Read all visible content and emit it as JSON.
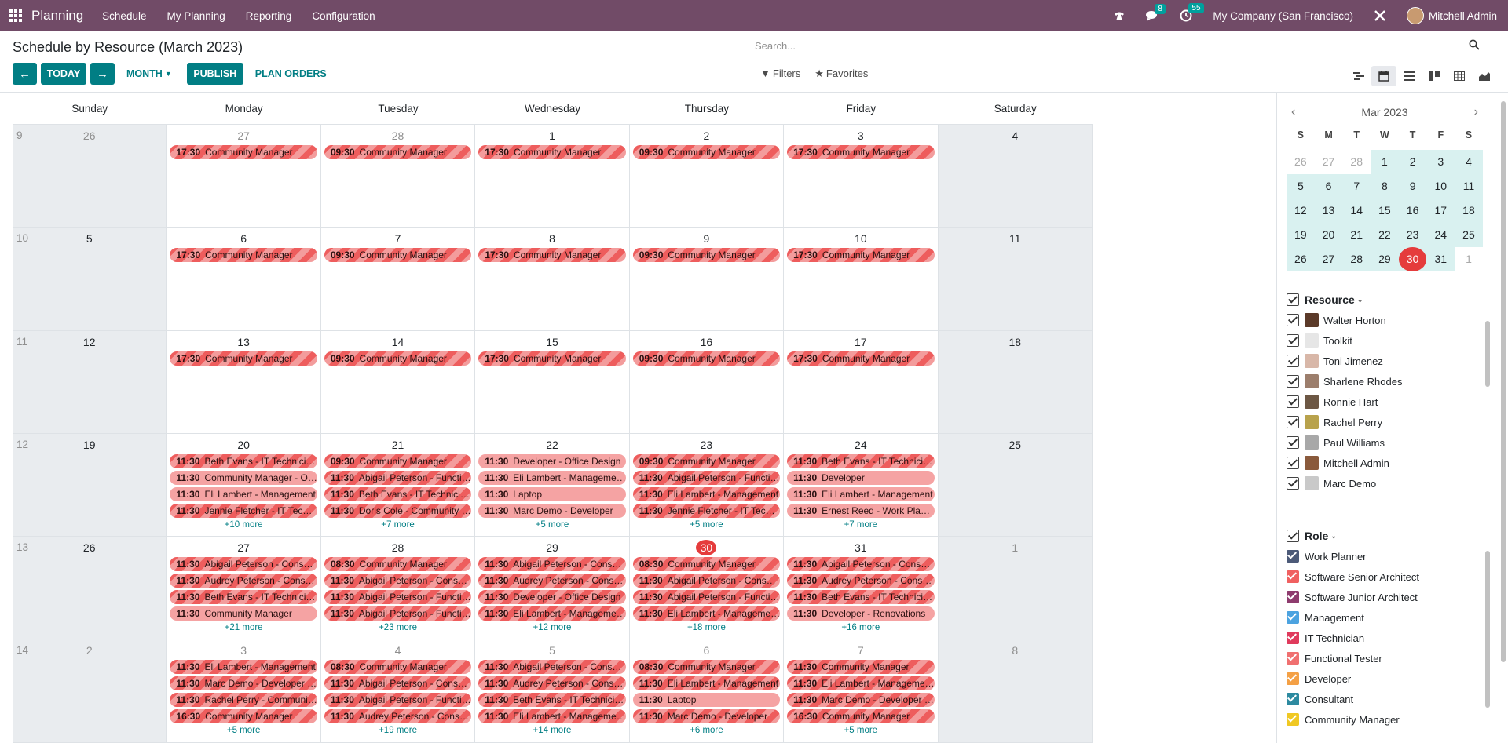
{
  "topbar": {
    "brand": "Planning",
    "menu": [
      "Schedule",
      "My Planning",
      "Reporting",
      "Configuration"
    ],
    "messages_badge": "8",
    "activities_badge": "55",
    "company": "My Company (San Francisco)",
    "user": "Mitchell Admin",
    "accent": "#714b67"
  },
  "control": {
    "title": "Schedule by Resource (March 2023)",
    "search_placeholder": "Search...",
    "prev_label": "←",
    "next_label": "→",
    "today_label": "TODAY",
    "scale_label": "MONTH",
    "publish_label": "PUBLISH",
    "plan_orders_label": "PLAN ORDERS",
    "filters_label": "Filters",
    "favorites_label": "Favorites",
    "primary": "#017e84"
  },
  "calendar": {
    "weekdays": [
      "Sunday",
      "Monday",
      "Tuesday",
      "Wednesday",
      "Thursday",
      "Friday",
      "Saturday"
    ],
    "weeks": [
      {
        "num": "9",
        "days": [
          {
            "d": "26",
            "dim": true,
            "events": [],
            "more": ""
          },
          {
            "d": "27",
            "dim": true,
            "events": [
              {
                "t": "17:30",
                "n": "Community Manager",
                "s": true
              }
            ],
            "more": ""
          },
          {
            "d": "28",
            "dim": true,
            "events": [
              {
                "t": "09:30",
                "n": "Community Manager",
                "s": true
              }
            ],
            "more": ""
          },
          {
            "d": "1",
            "events": [
              {
                "t": "17:30",
                "n": "Community Manager",
                "s": true
              }
            ],
            "more": ""
          },
          {
            "d": "2",
            "events": [
              {
                "t": "09:30",
                "n": "Community Manager",
                "s": true
              }
            ],
            "more": ""
          },
          {
            "d": "3",
            "events": [
              {
                "t": "17:30",
                "n": "Community Manager",
                "s": true
              }
            ],
            "more": ""
          },
          {
            "d": "4",
            "events": [],
            "more": ""
          }
        ]
      },
      {
        "num": "10",
        "days": [
          {
            "d": "5",
            "events": [],
            "more": ""
          },
          {
            "d": "6",
            "events": [
              {
                "t": "17:30",
                "n": "Community Manager",
                "s": true
              }
            ],
            "more": ""
          },
          {
            "d": "7",
            "events": [
              {
                "t": "09:30",
                "n": "Community Manager",
                "s": true
              }
            ],
            "more": ""
          },
          {
            "d": "8",
            "events": [
              {
                "t": "17:30",
                "n": "Community Manager",
                "s": true
              }
            ],
            "more": ""
          },
          {
            "d": "9",
            "events": [
              {
                "t": "09:30",
                "n": "Community Manager",
                "s": true
              }
            ],
            "more": ""
          },
          {
            "d": "10",
            "events": [
              {
                "t": "17:30",
                "n": "Community Manager",
                "s": true
              }
            ],
            "more": ""
          },
          {
            "d": "11",
            "events": [],
            "more": ""
          }
        ]
      },
      {
        "num": "11",
        "days": [
          {
            "d": "12",
            "events": [],
            "more": ""
          },
          {
            "d": "13",
            "events": [
              {
                "t": "17:30",
                "n": "Community Manager",
                "s": true
              }
            ],
            "more": ""
          },
          {
            "d": "14",
            "events": [
              {
                "t": "09:30",
                "n": "Community Manager",
                "s": true
              }
            ],
            "more": ""
          },
          {
            "d": "15",
            "events": [
              {
                "t": "17:30",
                "n": "Community Manager",
                "s": true
              }
            ],
            "more": ""
          },
          {
            "d": "16",
            "events": [
              {
                "t": "09:30",
                "n": "Community Manager",
                "s": true
              }
            ],
            "more": ""
          },
          {
            "d": "17",
            "events": [
              {
                "t": "17:30",
                "n": "Community Manager",
                "s": true
              }
            ],
            "more": ""
          },
          {
            "d": "18",
            "events": [],
            "more": ""
          }
        ]
      },
      {
        "num": "12",
        "days": [
          {
            "d": "19",
            "events": [],
            "more": ""
          },
          {
            "d": "20",
            "events": [
              {
                "t": "11:30",
                "n": "Beth Evans - IT Technician - S...",
                "s": true
              },
              {
                "t": "11:30",
                "n": "Community Manager - Offic...",
                "s": false
              },
              {
                "t": "11:30",
                "n": "Eli Lambert - Management",
                "s": false
              },
              {
                "t": "11:30",
                "n": "Jennie Fletcher - IT Technici...",
                "s": true
              }
            ],
            "more": "+10 more"
          },
          {
            "d": "21",
            "events": [
              {
                "t": "09:30",
                "n": "Community Manager",
                "s": true
              },
              {
                "t": "11:30",
                "n": "Abigail Peterson - Functiona...",
                "s": true
              },
              {
                "t": "11:30",
                "n": "Beth Evans - IT Technician - S...",
                "s": true
              },
              {
                "t": "11:30",
                "n": "Doris Cole - Community Man...",
                "s": true
              }
            ],
            "more": "+7 more"
          },
          {
            "d": "22",
            "events": [
              {
                "t": "11:30",
                "n": "Developer - Office Design",
                "s": false
              },
              {
                "t": "11:30",
                "n": "Eli Lambert - Management - ...",
                "s": false
              },
              {
                "t": "11:30",
                "n": "Laptop",
                "s": false
              },
              {
                "t": "11:30",
                "n": "Marc Demo - Developer",
                "s": false
              }
            ],
            "more": "+5 more"
          },
          {
            "d": "23",
            "events": [
              {
                "t": "09:30",
                "n": "Community Manager",
                "s": true
              },
              {
                "t": "11:30",
                "n": "Abigail Peterson - Functiona...",
                "s": true
              },
              {
                "t": "11:30",
                "n": "Eli Lambert - Management",
                "s": true
              },
              {
                "t": "11:30",
                "n": "Jennie Fletcher - IT Technici...",
                "s": true
              }
            ],
            "more": "+5 more"
          },
          {
            "d": "24",
            "events": [
              {
                "t": "11:30",
                "n": "Beth Evans - IT Technician - S...",
                "s": true
              },
              {
                "t": "11:30",
                "n": "Developer",
                "s": false
              },
              {
                "t": "11:30",
                "n": "Eli Lambert - Management",
                "s": false
              },
              {
                "t": "11:30",
                "n": "Ernest Reed - Work Planner - ...",
                "s": false
              }
            ],
            "more": "+7 more"
          },
          {
            "d": "25",
            "events": [],
            "more": ""
          }
        ]
      },
      {
        "num": "13",
        "days": [
          {
            "d": "26",
            "events": [],
            "more": ""
          },
          {
            "d": "27",
            "events": [
              {
                "t": "11:30",
                "n": "Abigail Peterson - Consultant",
                "s": true
              },
              {
                "t": "11:30",
                "n": "Audrey Peterson - Consultan...",
                "s": true
              },
              {
                "t": "11:30",
                "n": "Beth Evans - IT Technician - S...",
                "s": true
              },
              {
                "t": "11:30",
                "n": "Community Manager",
                "s": false
              }
            ],
            "more": "+21 more"
          },
          {
            "d": "28",
            "events": [
              {
                "t": "08:30",
                "n": "Community Manager",
                "s": true
              },
              {
                "t": "11:30",
                "n": "Abigail Peterson - Consultant",
                "s": true
              },
              {
                "t": "11:30",
                "n": "Abigail Peterson - Functiona...",
                "s": true
              },
              {
                "t": "11:30",
                "n": "Abigail Peterson - Functiona...",
                "s": true
              }
            ],
            "more": "+23 more"
          },
          {
            "d": "29",
            "events": [
              {
                "t": "11:30",
                "n": "Abigail Peterson - Consultant",
                "s": true
              },
              {
                "t": "11:30",
                "n": "Audrey Peterson - Consultant",
                "s": true
              },
              {
                "t": "11:30",
                "n": "Developer - Office Design",
                "s": true
              },
              {
                "t": "11:30",
                "n": "Eli Lambert - Management - ...",
                "s": true
              }
            ],
            "more": "+12 more"
          },
          {
            "d": "30",
            "today": true,
            "events": [
              {
                "t": "08:30",
                "n": "Community Manager",
                "s": true
              },
              {
                "t": "11:30",
                "n": "Abigail Peterson - Consultant",
                "s": true
              },
              {
                "t": "11:30",
                "n": "Abigail Peterson - Functiona...",
                "s": true
              },
              {
                "t": "11:30",
                "n": "Eli Lambert - Management - ...",
                "s": true
              }
            ],
            "more": "+18 more"
          },
          {
            "d": "31",
            "events": [
              {
                "t": "11:30",
                "n": "Abigail Peterson - Consultant",
                "s": true
              },
              {
                "t": "11:30",
                "n": "Audrey Peterson - Consultant",
                "s": true
              },
              {
                "t": "11:30",
                "n": "Beth Evans - IT Technician - S...",
                "s": true
              },
              {
                "t": "11:30",
                "n": "Developer - Renovations",
                "s": false
              }
            ],
            "more": "+16 more"
          },
          {
            "d": "1",
            "dim": true,
            "events": [],
            "more": ""
          }
        ]
      },
      {
        "num": "14",
        "days": [
          {
            "d": "2",
            "dim": true,
            "events": [],
            "more": ""
          },
          {
            "d": "3",
            "dim": true,
            "events": [
              {
                "t": "11:30",
                "n": "Eli Lambert - Management",
                "s": true
              },
              {
                "t": "11:30",
                "n": "Marc Demo - Developer - Re...",
                "s": true
              },
              {
                "t": "11:30",
                "n": "Rachel Perry - Community M...",
                "s": true
              },
              {
                "t": "16:30",
                "n": "Community Manager",
                "s": true
              }
            ],
            "more": "+5 more"
          },
          {
            "d": "4",
            "dim": true,
            "events": [
              {
                "t": "08:30",
                "n": "Community Manager",
                "s": true
              },
              {
                "t": "11:30",
                "n": "Abigail Peterson - Consultant",
                "s": true
              },
              {
                "t": "11:30",
                "n": "Abigail Peterson - Functiona...",
                "s": true
              },
              {
                "t": "11:30",
                "n": "Audrey Peterson - Consultant",
                "s": true
              }
            ],
            "more": "+19 more"
          },
          {
            "d": "5",
            "dim": true,
            "events": [
              {
                "t": "11:30",
                "n": "Abigail Peterson - Consultant",
                "s": true
              },
              {
                "t": "11:30",
                "n": "Audrey Peterson - Consultant",
                "s": true
              },
              {
                "t": "11:30",
                "n": "Beth Evans - IT Technician - S...",
                "s": true
              },
              {
                "t": "11:30",
                "n": "Eli Lambert - Management - ...",
                "s": true
              }
            ],
            "more": "+14 more"
          },
          {
            "d": "6",
            "dim": true,
            "events": [
              {
                "t": "08:30",
                "n": "Community Manager",
                "s": true
              },
              {
                "t": "11:30",
                "n": "Eli Lambert - Management",
                "s": true
              },
              {
                "t": "11:30",
                "n": "Laptop",
                "s": false
              },
              {
                "t": "11:30",
                "n": "Marc Demo - Developer",
                "s": true
              }
            ],
            "more": "+6 more"
          },
          {
            "d": "7",
            "dim": true,
            "events": [
              {
                "t": "11:30",
                "n": "Community Manager",
                "s": true
              },
              {
                "t": "11:30",
                "n": "Eli Lambert - Management - ...",
                "s": true
              },
              {
                "t": "11:30",
                "n": "Marc Demo - Developer - Re...",
                "s": true
              },
              {
                "t": "16:30",
                "n": "Community Manager",
                "s": true
              }
            ],
            "more": "+5 more"
          },
          {
            "d": "8",
            "dim": true,
            "events": [],
            "more": ""
          }
        ]
      }
    ]
  },
  "mini_calendar": {
    "title": "Mar 2023",
    "dow": [
      "S",
      "M",
      "T",
      "W",
      "T",
      "F",
      "S"
    ],
    "rows": [
      [
        "26",
        "27",
        "28",
        "1",
        "2",
        "3",
        "4"
      ],
      [
        "5",
        "6",
        "7",
        "8",
        "9",
        "10",
        "11"
      ],
      [
        "12",
        "13",
        "14",
        "15",
        "16",
        "17",
        "18"
      ],
      [
        "19",
        "20",
        "21",
        "22",
        "23",
        "24",
        "25"
      ],
      [
        "26",
        "27",
        "28",
        "29",
        "30",
        "31",
        "1"
      ]
    ]
  },
  "resource_filter": {
    "label": "Resource",
    "items": [
      {
        "name": "Walter Horton",
        "color": "#5b3a29"
      },
      {
        "name": "Toolkit",
        "color": "#e6e6e6"
      },
      {
        "name": "Toni Jimenez",
        "color": "#d8b7a8"
      },
      {
        "name": "Sharlene Rhodes",
        "color": "#9c7e6c"
      },
      {
        "name": "Ronnie Hart",
        "color": "#6d5744"
      },
      {
        "name": "Rachel Perry",
        "color": "#b8a24c"
      },
      {
        "name": "Paul Williams",
        "color": "#a8a8a8"
      },
      {
        "name": "Mitchell Admin",
        "color": "#8a5a3c"
      },
      {
        "name": "Marc Demo",
        "color": "#c9c9c9"
      }
    ]
  },
  "role_filter": {
    "label": "Role",
    "items": [
      {
        "name": "Work Planner",
        "color": "#4c5a78"
      },
      {
        "name": "Software Senior Architect",
        "color": "#f06060"
      },
      {
        "name": "Software Junior Architect",
        "color": "#8e3b6e"
      },
      {
        "name": "Management",
        "color": "#4ca3e0"
      },
      {
        "name": "IT Technician",
        "color": "#e03a5c"
      },
      {
        "name": "Functional Tester",
        "color": "#f07070"
      },
      {
        "name": "Developer",
        "color": "#f4a045"
      },
      {
        "name": "Consultant",
        "color": "#2d8aa0"
      },
      {
        "name": "Community Manager",
        "color": "#f0c823"
      }
    ]
  }
}
